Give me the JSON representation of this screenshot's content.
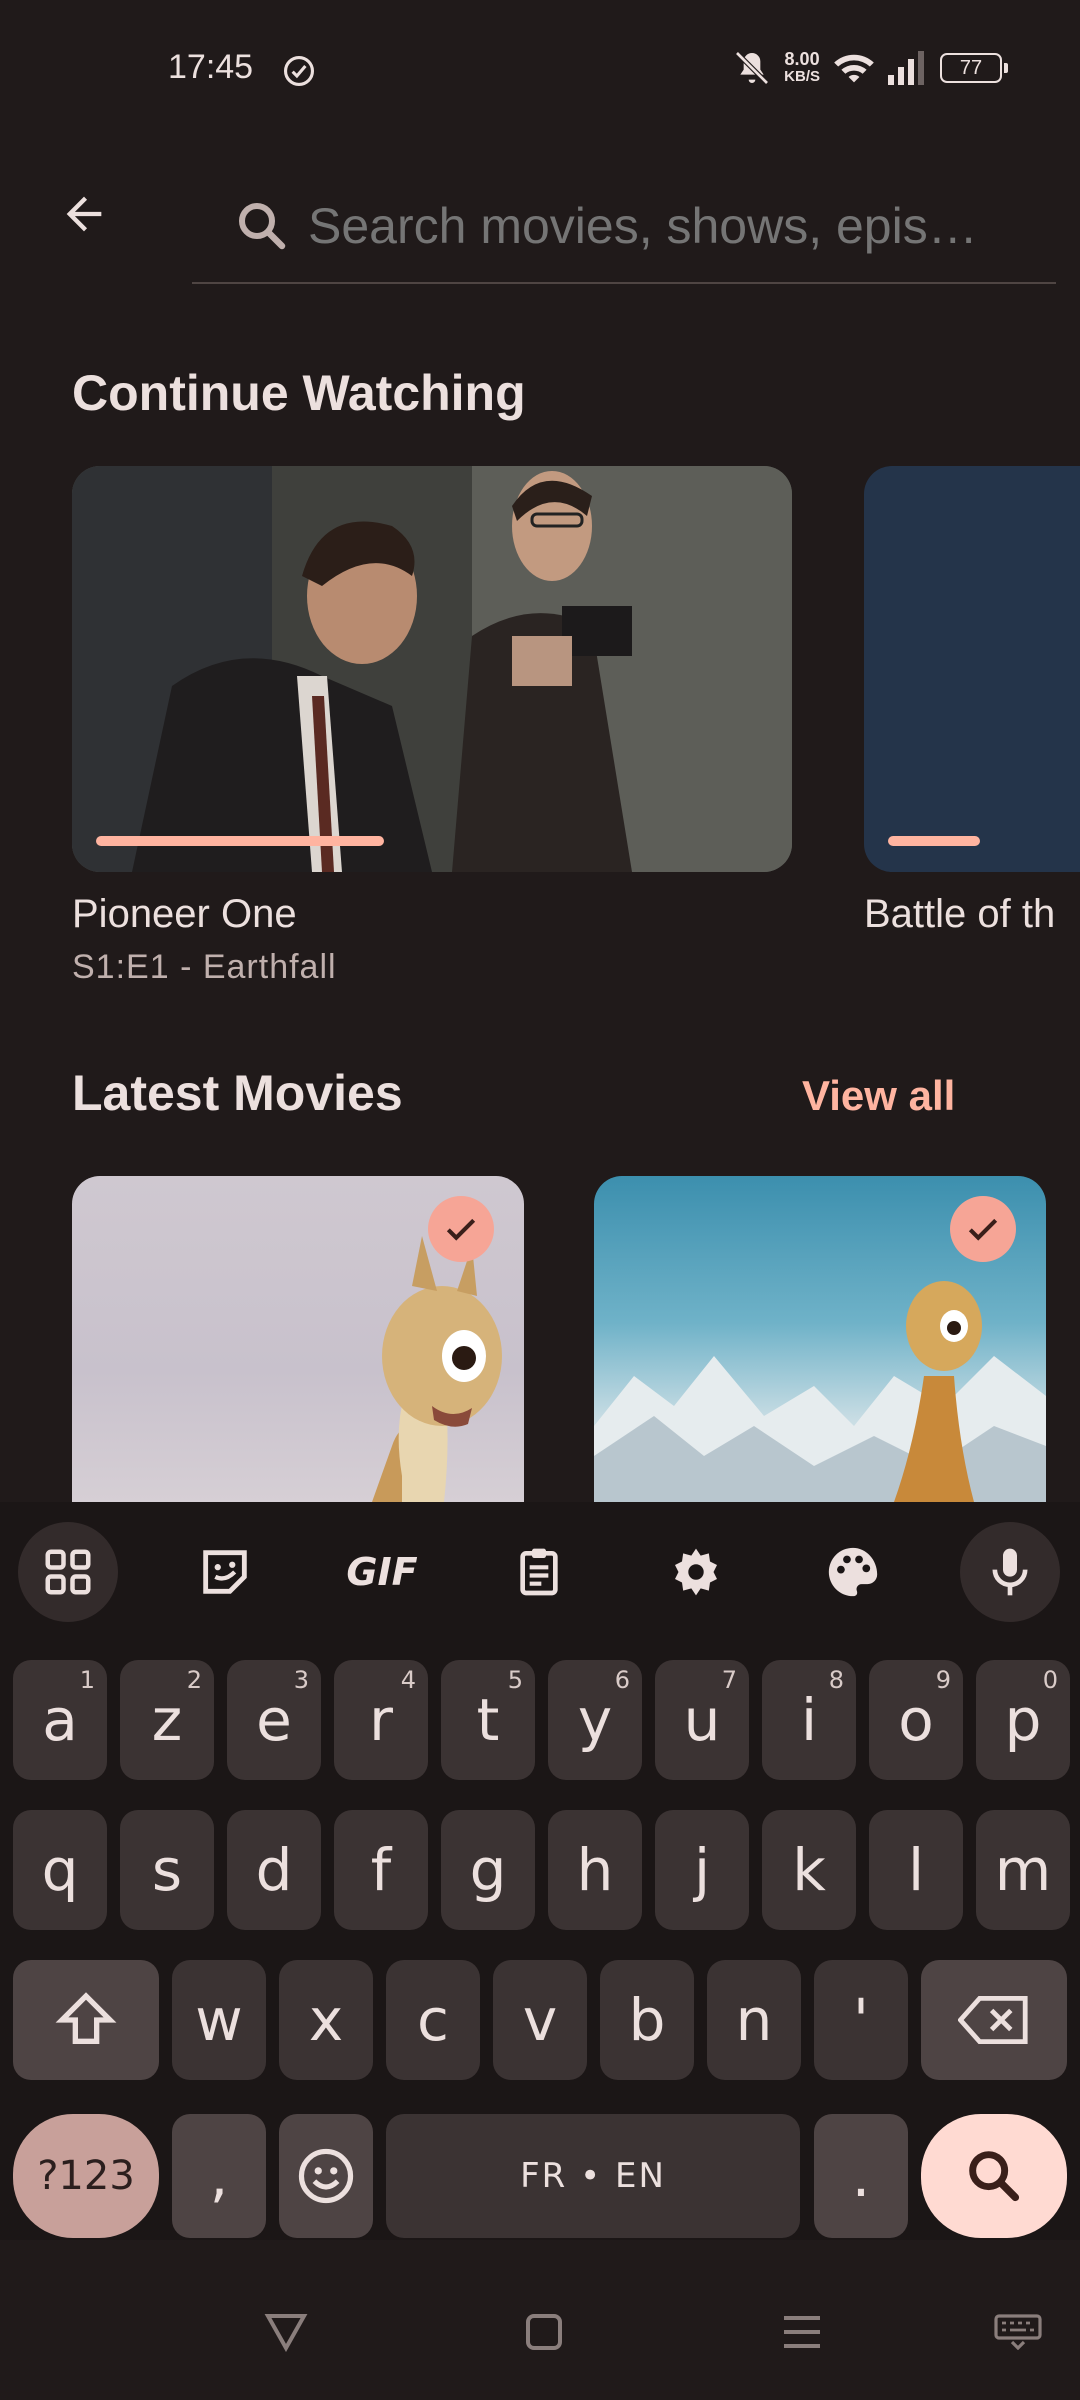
{
  "status_bar": {
    "time": "17:45",
    "speed_value": "8.00",
    "speed_unit": "KB/S",
    "battery": "77"
  },
  "search": {
    "placeholder": "Search movies, shows, epis…"
  },
  "continue_watching": {
    "title": "Continue Watching",
    "items": [
      {
        "name": "Pioneer One",
        "subtitle": "S1:E1 - Earthfall",
        "progress": 0.42
      },
      {
        "name": "Battle of th",
        "subtitle": "",
        "progress": 0.3
      }
    ]
  },
  "latest_movies": {
    "title": "Latest Movies",
    "view_all": "View all",
    "items": [
      {
        "watched": true
      },
      {
        "watched": true
      }
    ]
  },
  "keyboard": {
    "row1": [
      {
        "key": "a",
        "hint": "1"
      },
      {
        "key": "z",
        "hint": "2"
      },
      {
        "key": "e",
        "hint": "3"
      },
      {
        "key": "r",
        "hint": "4"
      },
      {
        "key": "t",
        "hint": "5"
      },
      {
        "key": "y",
        "hint": "6"
      },
      {
        "key": "u",
        "hint": "7"
      },
      {
        "key": "i",
        "hint": "8"
      },
      {
        "key": "o",
        "hint": "9"
      },
      {
        "key": "p",
        "hint": "0"
      }
    ],
    "row2": [
      "q",
      "s",
      "d",
      "f",
      "g",
      "h",
      "j",
      "k",
      "l",
      "m"
    ],
    "row3": [
      "w",
      "x",
      "c",
      "v",
      "b",
      "n",
      "'"
    ],
    "symbols": "?123",
    "comma": ",",
    "space": "FR • EN",
    "period": ".",
    "gif": "GIF"
  }
}
